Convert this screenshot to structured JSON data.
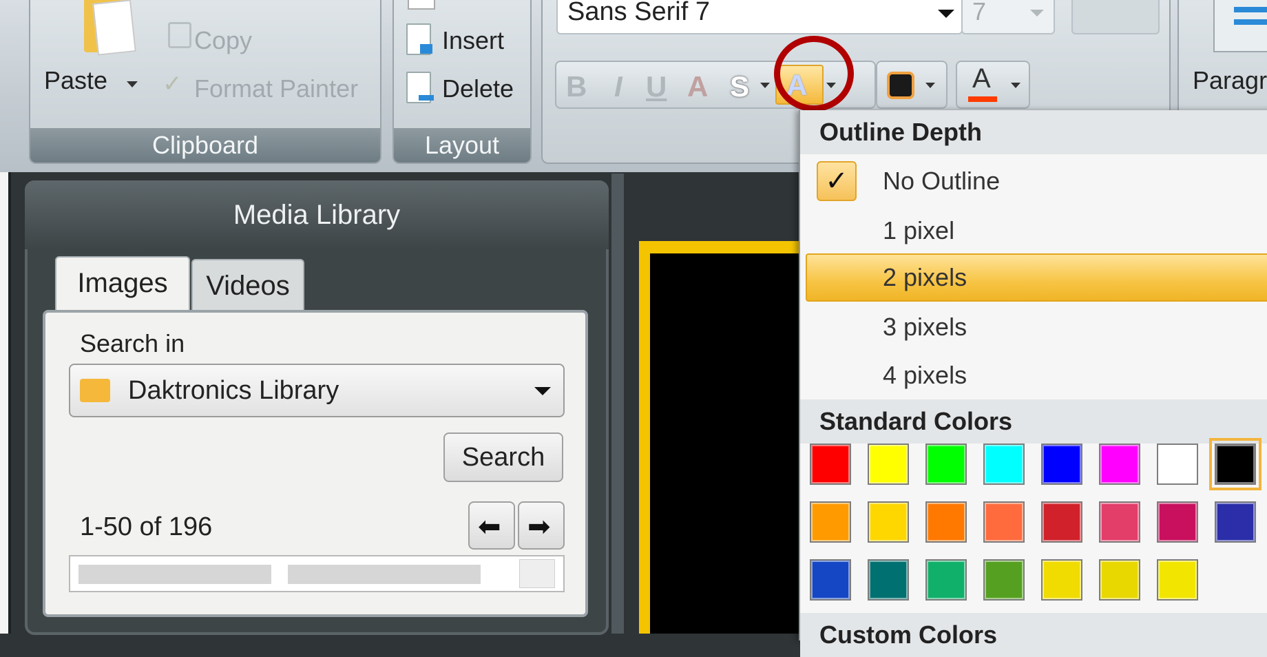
{
  "ribbon": {
    "clipboard": {
      "paste_label": "Paste",
      "copy_label": "Copy",
      "format_painter_label": "Format Painter",
      "group_label": "Clipboard"
    },
    "layout": {
      "insert_label": "Insert",
      "delete_label": "Delete",
      "group_label": "Layout"
    },
    "font": {
      "font_name": "Sans Serif 7",
      "font_size": "7",
      "bold": "B",
      "italic": "I",
      "underline": "U",
      "shadow": "A",
      "stroke": "S",
      "outline_button_glyph": "A",
      "font_color_glyph": "A"
    },
    "paragraph_label": "Paragr"
  },
  "media_library": {
    "title": "Media Library",
    "tabs": [
      "Images",
      "Videos"
    ],
    "search_in_label": "Search in",
    "library_select": "Daktronics Library",
    "search_button": "Search",
    "paging": "1-50 of 196"
  },
  "dropdown": {
    "outline_depth_header": "Outline Depth",
    "outline_options": [
      "No Outline",
      "1 pixel",
      "2 pixels",
      "3 pixels",
      "4 pixels"
    ],
    "checked_option": "No Outline",
    "highlighted_option": "2 pixels",
    "standard_colors_header": "Standard Colors",
    "custom_colors_header": "Custom Colors",
    "colors_row1": [
      "#ff0000",
      "#ffff00",
      "#00ff00",
      "#00ffff",
      "#0000ff",
      "#ff00ff",
      "#ffffff",
      "#000000"
    ],
    "colors_row2": [
      "#ff9a00",
      "#ffd700",
      "#ff7800",
      "#ff6b3d",
      "#d1212b",
      "#e33d6a",
      "#c8105e",
      "#2b2ea8"
    ],
    "colors_row3": [
      "#1547c4",
      "#007070",
      "#10b06a",
      "#55a020",
      "#f0dc00",
      "#e8d800",
      "#f2e600"
    ],
    "active_color": "#000000"
  },
  "colors": {
    "accent_highlight": "#f7c444",
    "callout_ring": "#b00000",
    "canvas_border": "#f4c400"
  }
}
